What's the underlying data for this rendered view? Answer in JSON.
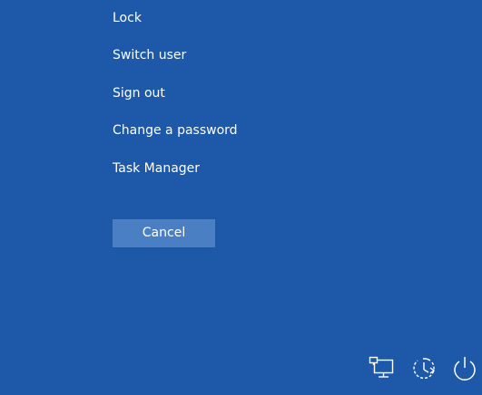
{
  "menu": {
    "items": [
      {
        "label": "Lock"
      },
      {
        "label": "Switch user"
      },
      {
        "label": "Sign out"
      },
      {
        "label": "Change a password"
      },
      {
        "label": "Task Manager"
      }
    ]
  },
  "cancel_button": {
    "label": "Cancel"
  },
  "tray": {
    "icons": [
      {
        "name": "network-icon"
      },
      {
        "name": "ease-of-access-icon"
      },
      {
        "name": "power-icon"
      }
    ]
  },
  "colors": {
    "background": "#1e58a8",
    "button": "#4a7fc3",
    "text": "#ffffff"
  }
}
